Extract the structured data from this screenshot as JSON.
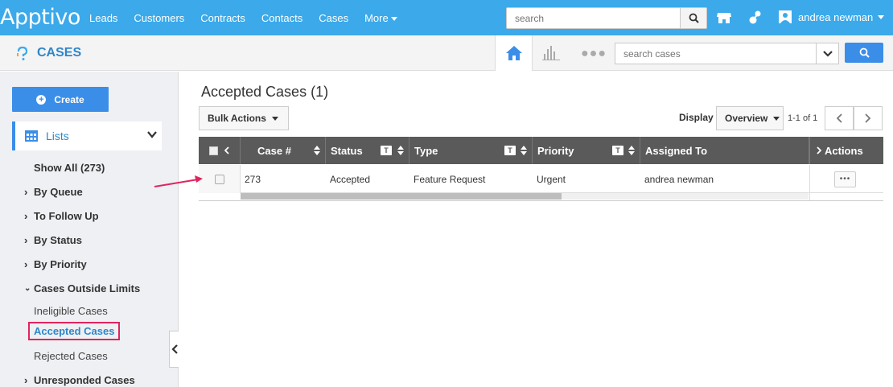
{
  "brand": {
    "name": "Apptivo",
    "accent": "#3ba9ea",
    "button_blue": "#3b8ee8",
    "highlight": "#e0245e"
  },
  "nav": {
    "links": [
      "Leads",
      "Customers",
      "Contracts",
      "Contacts",
      "Cases"
    ],
    "more": "More"
  },
  "global_search": {
    "placeholder": "search",
    "icon": "search-icon"
  },
  "top_icons": [
    "store-icon",
    "apps-icon"
  ],
  "user": {
    "name": "andrea newman",
    "icon": "user-avatar-icon"
  },
  "app": {
    "title": "CASES",
    "icon": "help-circle-icon",
    "views": [
      "home-icon",
      "bar-chart-icon",
      "more-dots-icon"
    ],
    "search_placeholder": "search cases"
  },
  "sidebar": {
    "create_label": "Create",
    "lists_label": "Lists",
    "show_all": "Show All (273)",
    "groups": [
      "By Queue",
      "To Follow Up",
      "By Status",
      "By Priority",
      "Cases Outside Limits"
    ],
    "outside_limits_items": [
      "Ineligible Cases",
      "Accepted Cases",
      "Rejected Cases"
    ],
    "unresponded": "Unresponded Cases"
  },
  "main": {
    "title": "Accepted Cases (1)",
    "bulk_actions": "Bulk Actions",
    "display_label": "Display",
    "display_value": "Overview",
    "page_info": "1-1 of 1"
  },
  "table": {
    "columns": [
      "Case #",
      "Status",
      "Type",
      "Priority",
      "Assigned To",
      "Actions"
    ],
    "filter_glyph": "T",
    "rows": [
      {
        "case_no": "273",
        "status": "Accepted",
        "type": "Feature Request",
        "priority": "Urgent",
        "assigned_to": "andrea newman",
        "actions": "•••"
      }
    ]
  }
}
